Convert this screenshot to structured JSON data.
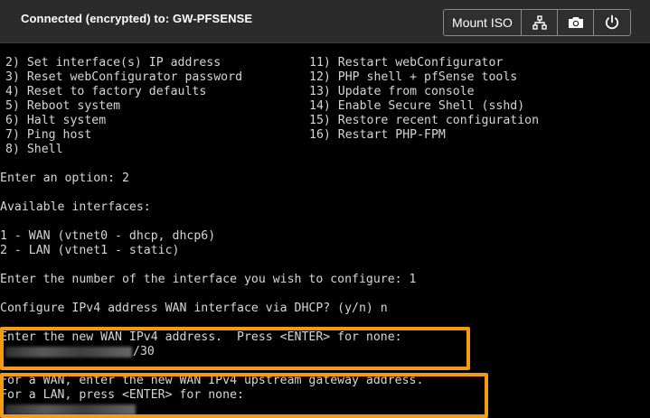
{
  "header": {
    "title": "Connected (encrypted) to: GW-PFSENSE",
    "mount_label": "Mount ISO",
    "buttons": [
      {
        "name": "network-icon"
      },
      {
        "name": "camera-icon"
      },
      {
        "name": "power-icon"
      }
    ]
  },
  "console": {
    "menu_left": [
      "2) Set interface(s) IP address",
      "3) Reset webConfigurator password",
      "4) Reset to factory defaults",
      "5) Reboot system",
      "6) Halt system",
      "7) Ping host",
      "8) Shell"
    ],
    "menu_right": [
      "11) Restart webConfigurator",
      "12) PHP shell + pfSense tools",
      "13) Update from console",
      "14) Enable Secure Shell (sshd)",
      "15) Restore recent configuration",
      "16) Restart PHP-FPM"
    ],
    "prompt_option": "Enter an option: 2",
    "available_interfaces": "Available interfaces:",
    "iface_wan": "1 - WAN (vtnet0 - dhcp, dhcp6)",
    "iface_lan": "2 - LAN (vtnet1 - static)",
    "prompt_interface": "Enter the number of the interface you wish to configure: 1",
    "prompt_dhcp": "Configure IPv4 address WAN interface via DHCP? (y/n) n",
    "prompt_new_ip": "Enter the new WAN IPv4 address.  Press <ENTER> for none:",
    "ip_suffix": "/30",
    "prompt_gateway_1": "For a WAN, enter the new WAN IPv4 upstream gateway address.",
    "prompt_gateway_2": "For a LAN, press <ENTER> for none:"
  },
  "colors": {
    "highlight": "#f39c12",
    "topbar": "#2b2b2b",
    "console_text": "#d6d6d6"
  }
}
